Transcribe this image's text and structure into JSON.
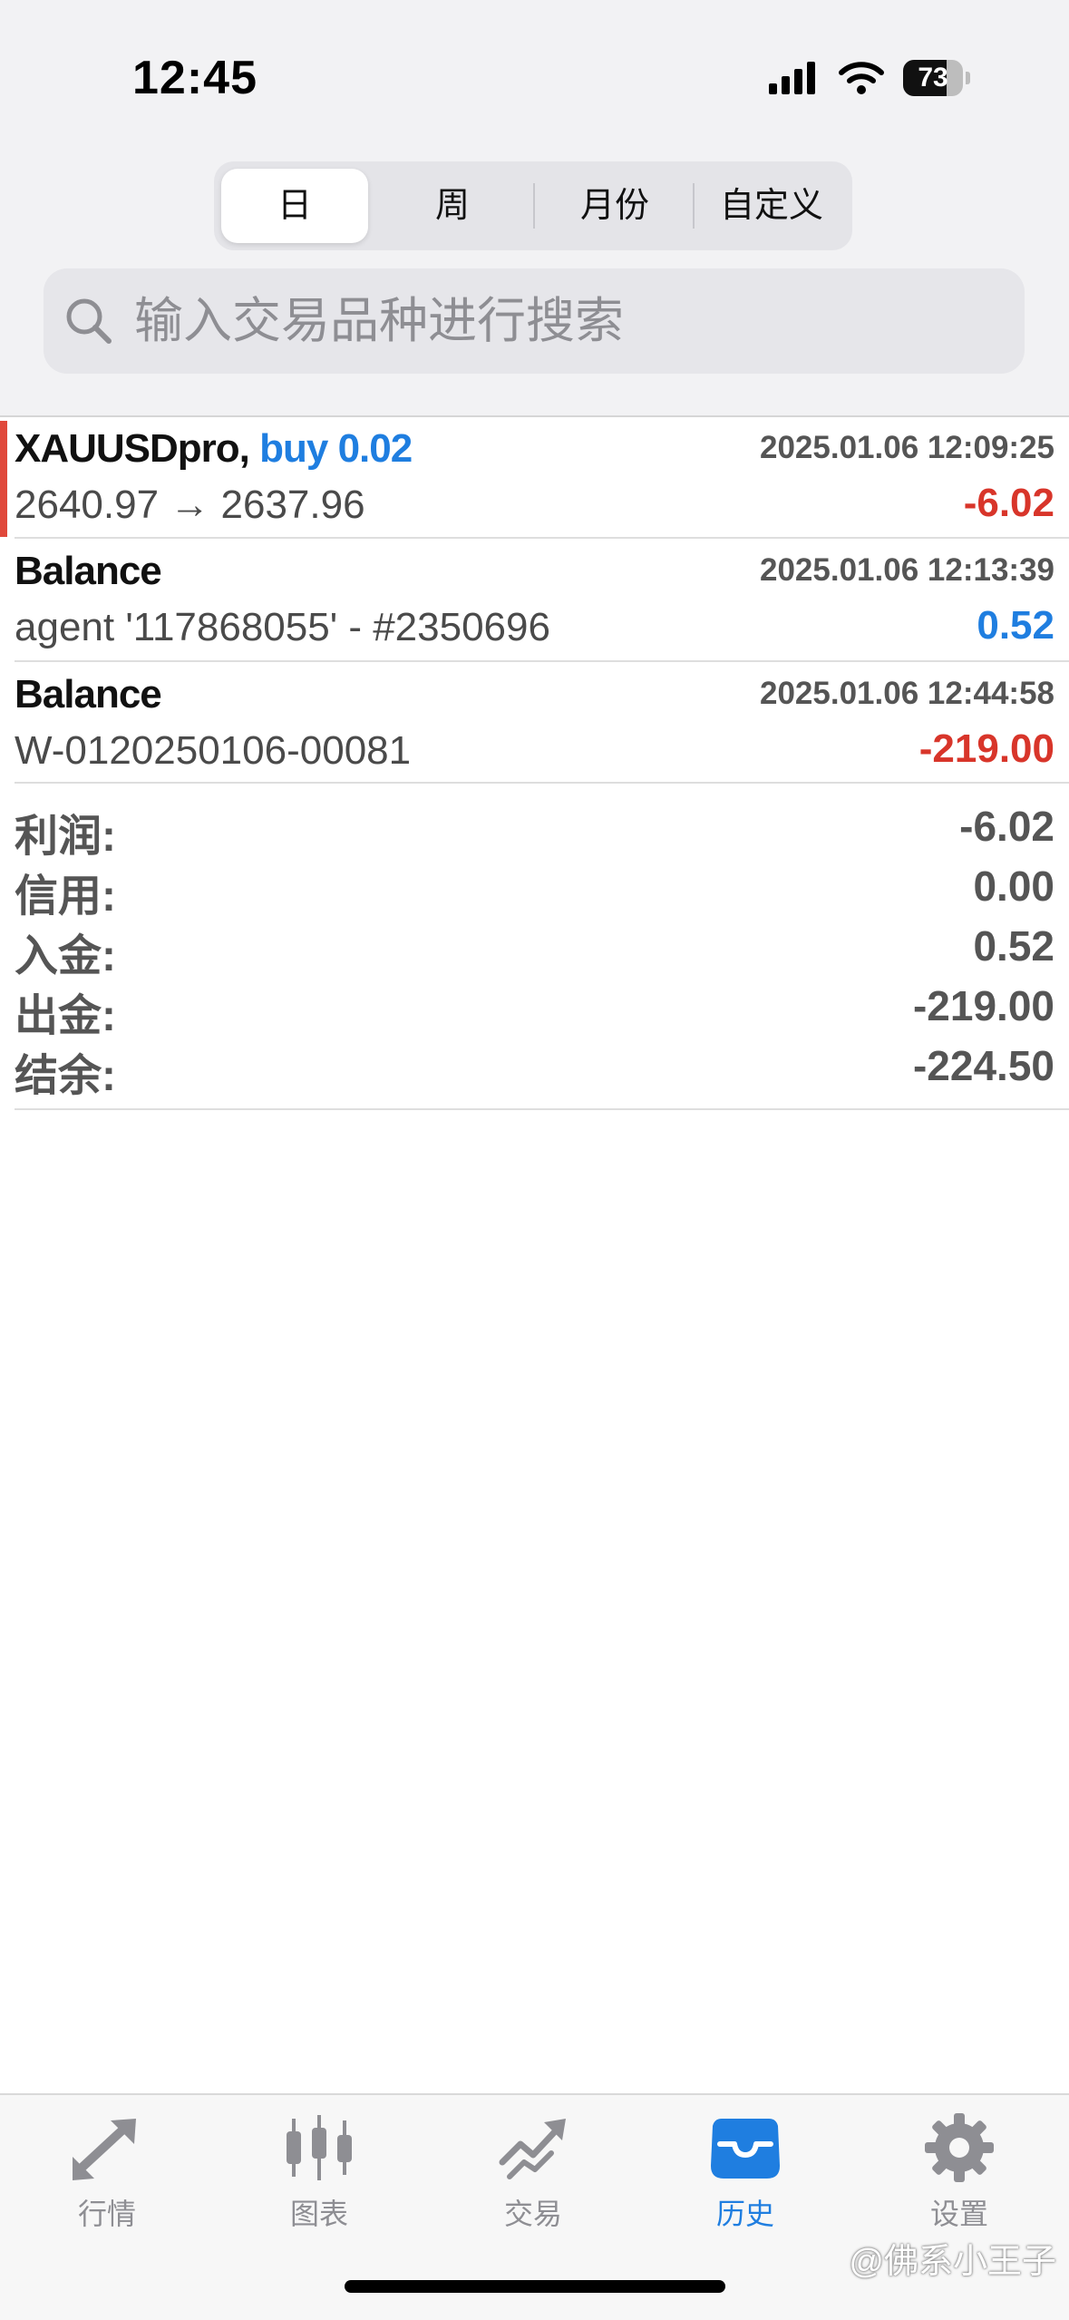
{
  "status_bar": {
    "time": "12:45",
    "battery": "73",
    "battery_level": 0.73
  },
  "period_tabs": [
    {
      "label": "日",
      "active": true
    },
    {
      "label": "周",
      "active": false
    },
    {
      "label": "月份",
      "active": false
    },
    {
      "label": "自定义",
      "active": false
    }
  ],
  "search": {
    "placeholder": "输入交易品种进行搜索"
  },
  "entries": [
    {
      "symbol": "XAUUSDpro,",
      "action": " buy 0.02",
      "time": "2025.01.06 12:09:25",
      "detail": "2640.97 → 2637.96",
      "amount": "-6.02",
      "amount_color": "#d8352a"
    },
    {
      "symbol": "Balance",
      "action": "",
      "time": "2025.01.06 12:13:39",
      "detail": "agent '117868055' - #2350696",
      "amount": "0.52",
      "amount_color": "#1f7ee0"
    },
    {
      "symbol": "Balance",
      "action": "",
      "time": "2025.01.06 12:44:58",
      "detail": "W-0120250106-00081",
      "amount": "-219.00",
      "amount_color": "#d8352a"
    }
  ],
  "summary": [
    {
      "label": "利润:",
      "value": "-6.02"
    },
    {
      "label": "信用:",
      "value": "0.00"
    },
    {
      "label": "入金:",
      "value": "0.52"
    },
    {
      "label": "出金:",
      "value": "-219.00"
    },
    {
      "label": "结余:",
      "value": "-224.50"
    }
  ],
  "tab_bar": [
    {
      "label": "行情",
      "icon": "quotes-arrows-icon",
      "active": false
    },
    {
      "label": "图表",
      "icon": "chart-candlestick-icon",
      "active": false
    },
    {
      "label": "交易",
      "icon": "trade-trend-icon",
      "active": false
    },
    {
      "label": "历史",
      "icon": "history-inbox-icon",
      "active": true
    },
    {
      "label": "设置",
      "icon": "settings-gear-icon",
      "active": false
    }
  ],
  "watermark": "@佛系小王子",
  "colors": {
    "accent": "#1f7ee0",
    "negative": "#d8352a",
    "trade_marker": "#e0483b"
  }
}
